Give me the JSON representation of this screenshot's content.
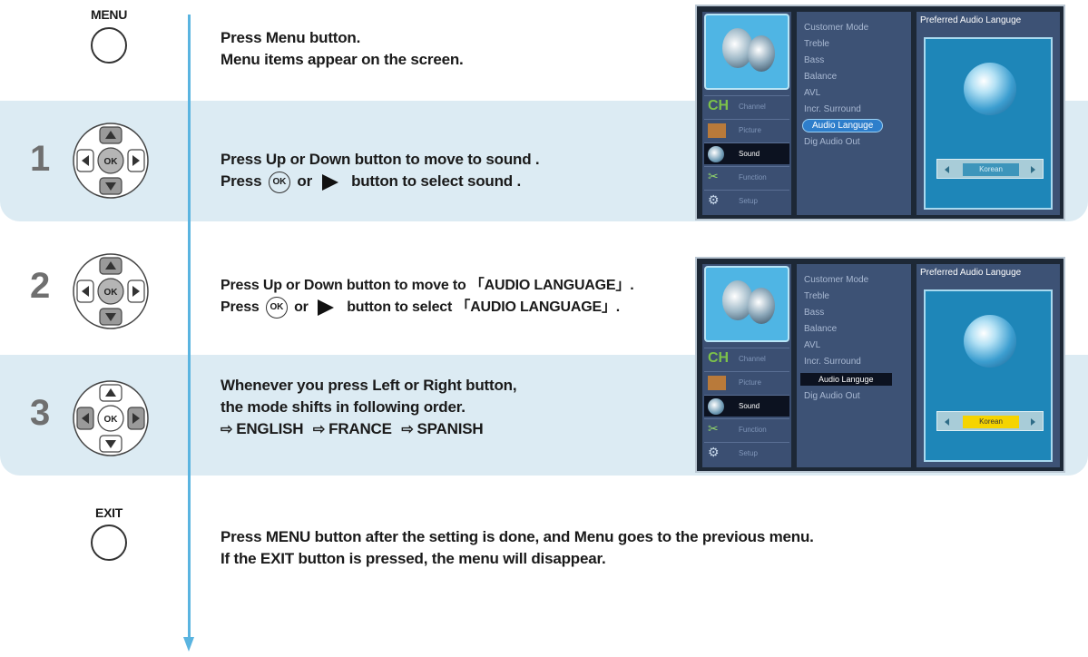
{
  "menu_button": {
    "caption": "MENU"
  },
  "exit_button": {
    "caption": "EXIT"
  },
  "intro": {
    "line1": "Press Menu button.",
    "line2": "Menu items appear on the screen."
  },
  "steps": [
    {
      "number": "1",
      "line1": "Press Up or Down button to move to sound .",
      "line2_prefix": "Press",
      "ok_label": "OK",
      "line2_or": "or",
      "line2_suffix": "button to select sound ."
    },
    {
      "number": "2",
      "line1_prefix": "Press Up or Down button to move to ",
      "line1_term": "AUDIO LANGUAGE",
      "line2_prefix": "Press",
      "ok_label": "OK",
      "line2_or": "or",
      "line2_suffix_pre": "button to select ",
      "line2_term": "AUDIO LANGUAGE",
      "open_bracket": "「",
      "close_bracket": "」",
      "period": "."
    },
    {
      "number": "3",
      "line1": "Whenever you press Left or Right button,",
      "line2": "the mode shifts in following order.",
      "modes": [
        "ENGLISH",
        "FRANCE",
        "SPANISH"
      ]
    }
  ],
  "outro": {
    "line1": "Press MENU button after the setting is done, and Menu goes to the previous menu.",
    "line2": "If the EXIT button is pressed, the menu will disappear."
  },
  "dpad": {
    "ok_label": "OK"
  },
  "osd": {
    "categories": [
      "Channel",
      "Picture",
      "Sound",
      "Function",
      "Setup"
    ],
    "selected_category": "Sound",
    "menu_items": [
      "Customer Mode",
      "Treble",
      "Bass",
      "Balance",
      "AVL",
      "Incr. Surround",
      "Audio Languge",
      "Dig Audio Out"
    ],
    "panel_title": "Preferred Audio Languge",
    "language_value": "Korean"
  },
  "colors": {
    "band": "#dcebf3",
    "flow_line": "#5ab4e0",
    "highlight_yellow": "#f5d400"
  }
}
